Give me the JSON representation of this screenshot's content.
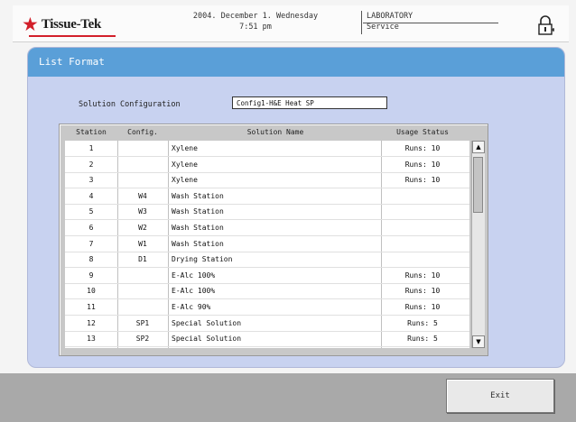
{
  "header": {
    "brand": "Tissue-Tek",
    "brand_mark": "★",
    "date": "2004. December 1. Wednesday",
    "time": "7:51 pm",
    "location": "LABORATORY",
    "mode": "Service",
    "brand_color": "#d21f2a"
  },
  "panel": {
    "title": "List Format",
    "config_label": "Solution Configuration",
    "config_value": "Config1-H&E Heat SP"
  },
  "table": {
    "headers": {
      "station": "Station",
      "config": "Config.",
      "name": "Solution Name",
      "usage": "Usage Status"
    },
    "rows": [
      {
        "station": "1",
        "config": "",
        "name": "Xylene",
        "usage": "Runs: 10"
      },
      {
        "station": "2",
        "config": "",
        "name": "Xylene",
        "usage": "Runs: 10"
      },
      {
        "station": "3",
        "config": "",
        "name": "Xylene",
        "usage": "Runs: 10"
      },
      {
        "station": "4",
        "config": "W4",
        "name": "Wash Station",
        "usage": ""
      },
      {
        "station": "5",
        "config": "W3",
        "name": "Wash Station",
        "usage": ""
      },
      {
        "station": "6",
        "config": "W2",
        "name": "Wash Station",
        "usage": ""
      },
      {
        "station": "7",
        "config": "W1",
        "name": "Wash Station",
        "usage": ""
      },
      {
        "station": "8",
        "config": "D1",
        "name": "Drying Station",
        "usage": ""
      },
      {
        "station": "9",
        "config": "",
        "name": "E-Alc 100%",
        "usage": "Runs: 10"
      },
      {
        "station": "10",
        "config": "",
        "name": "E-Alc 100%",
        "usage": "Runs: 10"
      },
      {
        "station": "11",
        "config": "",
        "name": "E-Alc 90%",
        "usage": "Runs: 10"
      },
      {
        "station": "12",
        "config": "SP1",
        "name": "Special Solution",
        "usage": "Runs: 5"
      },
      {
        "station": "13",
        "config": "SP2",
        "name": "Special Solution",
        "usage": "Runs: 5"
      }
    ]
  },
  "buttons": {
    "exit": "Exit"
  },
  "icons": {
    "lock": "lock-icon",
    "scroll_up": "▲",
    "scroll_down": "▼"
  }
}
